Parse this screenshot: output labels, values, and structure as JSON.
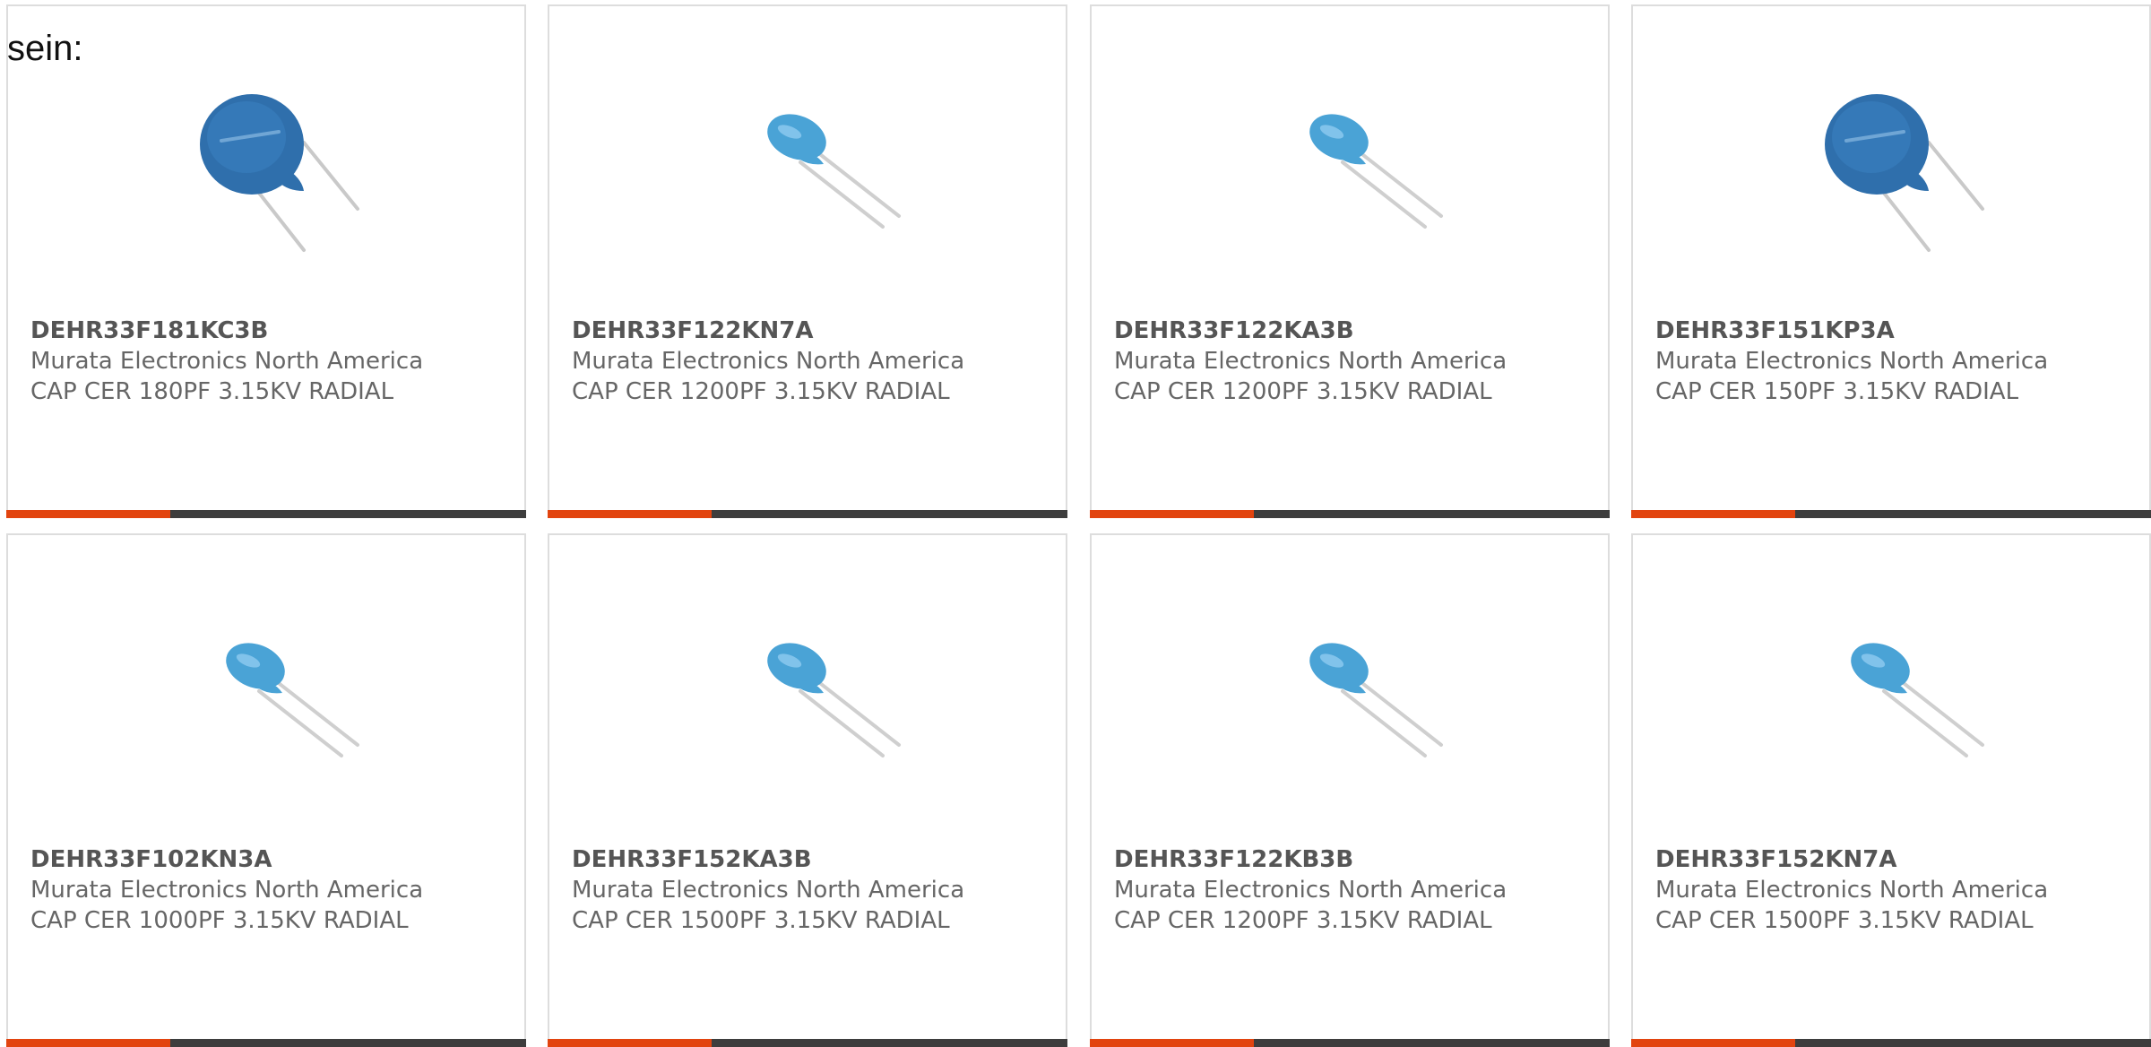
{
  "page": {
    "intro_text": "sein:"
  },
  "colors": {
    "accent": "#e2440f",
    "bar": "#3d3d3d",
    "card_border": "#dddddd",
    "text": "#666666",
    "capacitor_disc_large": "#2f6fac",
    "capacitor_disc_small": "#4aa3d6"
  },
  "products": [
    {
      "part_number": "DEHR33F181KC3B",
      "manufacturer": "Murata Electronics North America",
      "description": "CAP CER 180PF 3.15KV RADIAL",
      "image": "large-disc-capacitor"
    },
    {
      "part_number": "DEHR33F122KN7A",
      "manufacturer": "Murata Electronics North America",
      "description": "CAP CER 1200PF 3.15KV RADIAL",
      "image": "small-disc-capacitor"
    },
    {
      "part_number": "DEHR33F122KA3B",
      "manufacturer": "Murata Electronics North America",
      "description": "CAP CER 1200PF 3.15KV RADIAL",
      "image": "small-disc-capacitor"
    },
    {
      "part_number": "DEHR33F151KP3A",
      "manufacturer": "Murata Electronics North America",
      "description": "CAP CER 150PF 3.15KV RADIAL",
      "image": "large-disc-capacitor"
    },
    {
      "part_number": "DEHR33F102KN3A",
      "manufacturer": "Murata Electronics North America",
      "description": "CAP CER 1000PF 3.15KV RADIAL",
      "image": "small-disc-capacitor"
    },
    {
      "part_number": "DEHR33F152KA3B",
      "manufacturer": "Murata Electronics North America",
      "description": "CAP CER 1500PF 3.15KV RADIAL",
      "image": "small-disc-capacitor"
    },
    {
      "part_number": "DEHR33F122KB3B",
      "manufacturer": "Murata Electronics North America",
      "description": "CAP CER 1200PF 3.15KV RADIAL",
      "image": "small-disc-capacitor"
    },
    {
      "part_number": "DEHR33F152KN7A",
      "manufacturer": "Murata Electronics North America",
      "description": "CAP CER 1500PF 3.15KV RADIAL",
      "image": "small-disc-capacitor"
    }
  ]
}
